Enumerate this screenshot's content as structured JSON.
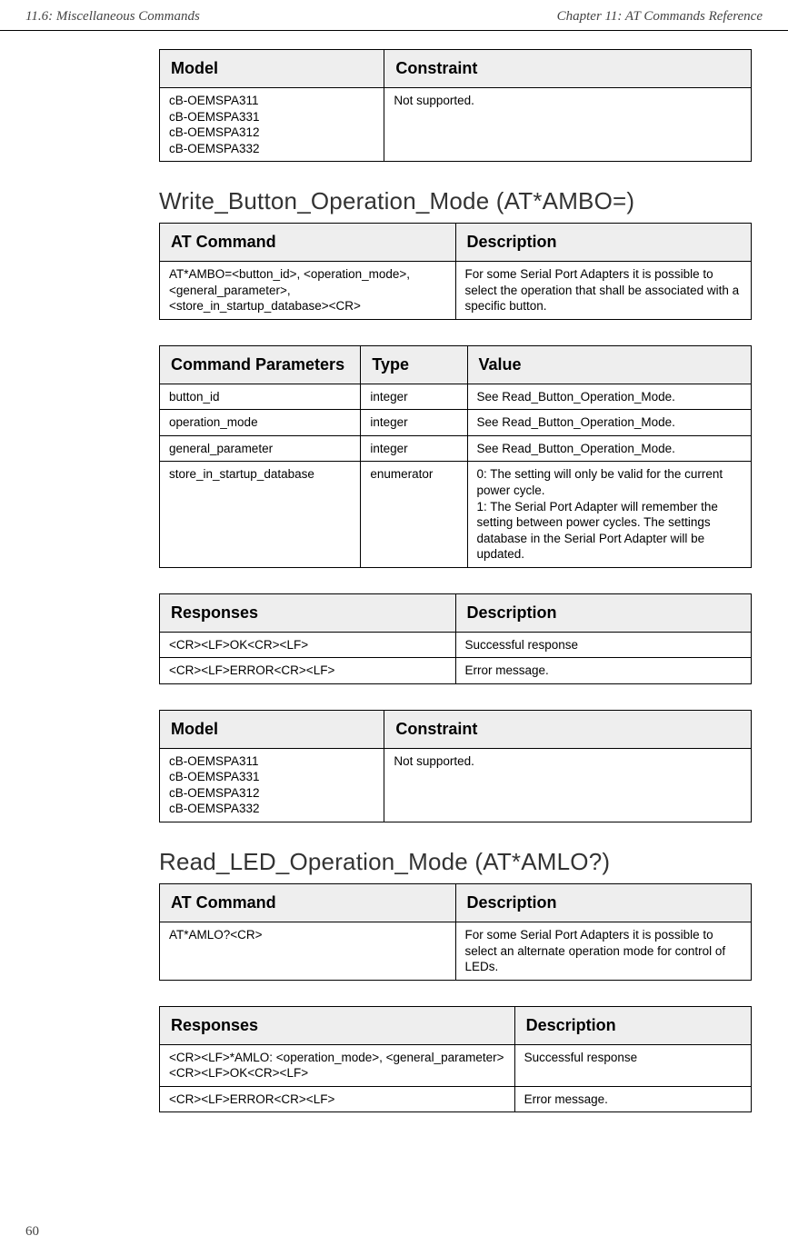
{
  "header": {
    "left": "11.6: Miscellaneous Commands",
    "right": "Chapter 11: AT Commands Reference"
  },
  "tables": {
    "t1": {
      "h1": "Model",
      "h2": "Constraint",
      "r1c1": "cB-OEMSPA311\ncB-OEMSPA331\ncB-OEMSPA312\ncB-OEMSPA332",
      "r1c2": "Not supported."
    },
    "sectionA": "Write_Button_Operation_Mode (AT*AMBO=)",
    "t2": {
      "h1": "AT Command",
      "h2": "Description",
      "r1c1": "AT*AMBO=<button_id>, <operation_mode>, <general_parameter>, <store_in_startup_database><CR>",
      "r1c2": "For some Serial Port Adapters it is possible to select the operation that shall be associated with a specific button."
    },
    "t3": {
      "h1": "Command Parameters",
      "h2": "Type",
      "h3": "Value",
      "r1c1": "button_id",
      "r1c2": "integer",
      "r1c3": "See Read_Button_Operation_Mode.",
      "r2c1": "operation_mode",
      "r2c2": "integer",
      "r2c3": "See Read_Button_Operation_Mode.",
      "r3c1": "general_parameter",
      "r3c2": "integer",
      "r3c3": "See Read_Button_Operation_Mode.",
      "r4c1": "store_in_startup_database",
      "r4c2": "enumerator",
      "r4c3": "0: The setting will only be valid for the current power cycle.\n1: The Serial Port Adapter will remember the setting between power cycles. The settings database in the Serial Port Adapter will be updated."
    },
    "t4": {
      "h1": "Responses",
      "h2": "Description",
      "r1c1": "<CR><LF>OK<CR><LF>",
      "r1c2": "Successful response",
      "r2c1": "<CR><LF>ERROR<CR><LF>",
      "r2c2": "Error message."
    },
    "t5": {
      "h1": "Model",
      "h2": "Constraint",
      "r1c1": "cB-OEMSPA311\ncB-OEMSPA331\ncB-OEMSPA312\ncB-OEMSPA332",
      "r1c2": "Not supported."
    },
    "sectionB": "Read_LED_Operation_Mode (AT*AMLO?)",
    "t6": {
      "h1": "AT Command",
      "h2": "Description",
      "r1c1": "AT*AMLO?<CR>",
      "r1c2": "For some Serial Port Adapters it is possible to select an alternate operation mode for control of LEDs."
    },
    "t7": {
      "h1": "Responses",
      "h2": "Description",
      "r1c1": "<CR><LF>*AMLO: <operation_mode>,  <general_parameter><CR><LF>OK<CR><LF>",
      "r1c2": "Successful response",
      "r2c1": "<CR><LF>ERROR<CR><LF>",
      "r2c2": "Error message."
    }
  },
  "pageNum": "60"
}
